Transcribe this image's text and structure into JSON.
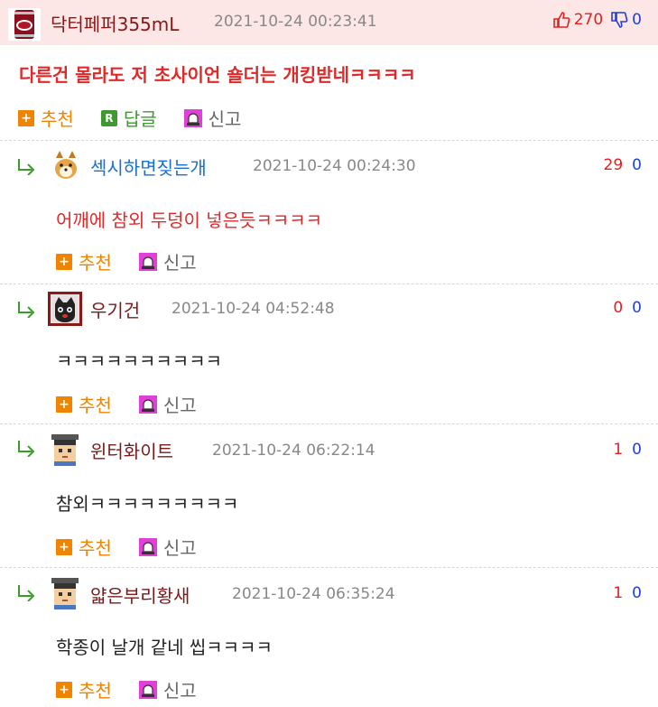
{
  "post": {
    "author": "닥터페퍼355mL",
    "time": "2021-10-24 00:23:41",
    "up": "270",
    "down": "0",
    "body": "다른건 몰라도 저 초사이언 숄더는 개킹받네ㅋㅋㅋㅋ",
    "actions": {
      "recommend": "추천",
      "reply": "답글",
      "report": "신고"
    }
  },
  "comments": [
    {
      "author": "섹시하면짖는개",
      "time": "2021-10-24 00:24:30",
      "up": "29",
      "down": "0",
      "body": "어깨에 참외 두덩이 넣은듯ㅋㅋㅋㅋ",
      "author_color": "#1a6fd1",
      "body_color": "#e02a2a",
      "avatar": "dog-avatar"
    },
    {
      "author": "우기건",
      "time": "2021-10-24 04:52:48",
      "up": "0",
      "down": "0",
      "body": "ㅋㅋㅋㅋㅋㅋㅋㅋㅋㅋ",
      "author_color": "#7a1a1a",
      "body_color": "#222222",
      "avatar": "cat-avatar"
    },
    {
      "author": "윈터화이트",
      "time": "2021-10-24 06:22:14",
      "up": "1",
      "down": "0",
      "body": "참외ㅋㅋㅋㅋㅋㅋㅋㅋㅋ",
      "author_color": "#7a1a1a",
      "body_color": "#222222",
      "avatar": "pixel-person-avatar"
    },
    {
      "author": "얇은부리황새",
      "time": "2021-10-24 06:35:24",
      "up": "1",
      "down": "0",
      "body": "학종이 날개 같네 씹ㅋㅋㅋㅋ",
      "author_color": "#7a1a1a",
      "body_color": "#222222",
      "avatar": "pixel-person-avatar"
    }
  ],
  "comment_actions": {
    "recommend": "추천",
    "report": "신고"
  },
  "colors": {
    "header_bg": "#fde6e6",
    "recommend": "#f08400",
    "reply": "#3c9a2f",
    "up": "#e02020",
    "down": "#1f3fd6"
  }
}
